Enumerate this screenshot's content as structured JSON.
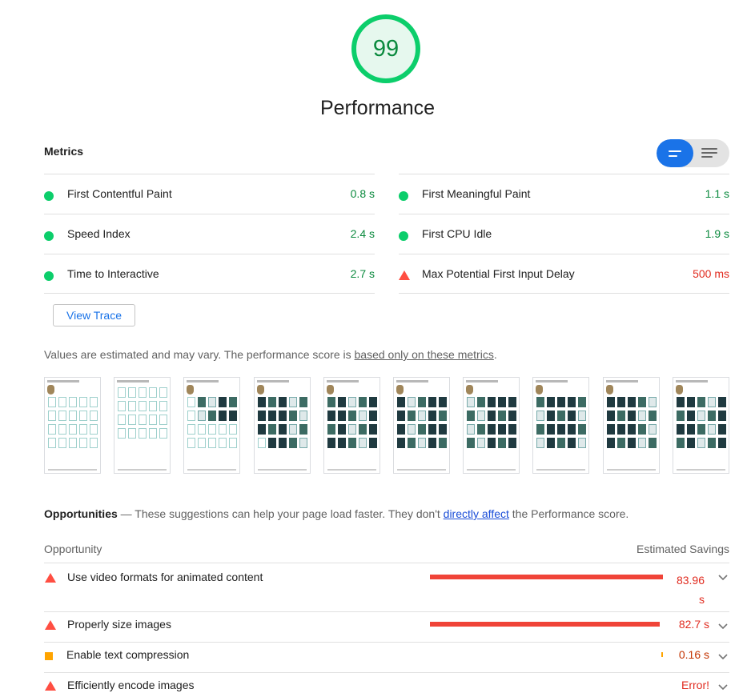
{
  "gauge": {
    "score": "99",
    "title": "Performance",
    "color": "#0cce6b"
  },
  "metrics": {
    "title": "Metrics",
    "toggle": {
      "selected": "summary-view",
      "options": [
        "summary-icon",
        "list-icon"
      ],
      "accent": "#1a73e8"
    },
    "items": [
      {
        "label": "First Contentful Paint",
        "value": "0.8 s",
        "status": "pass"
      },
      {
        "label": "First Meaningful Paint",
        "value": "1.1 s",
        "status": "pass"
      },
      {
        "label": "Speed Index",
        "value": "2.4 s",
        "status": "pass"
      },
      {
        "label": "First CPU Idle",
        "value": "1.9 s",
        "status": "pass"
      },
      {
        "label": "Time to Interactive",
        "value": "2.7 s",
        "status": "pass"
      },
      {
        "label": "Max Potential First Input Delay",
        "value": "500 ms",
        "status": "fail"
      }
    ],
    "view_trace_label": "View Trace",
    "note_prefix": "Values are estimated and may vary. The performance score is ",
    "note_link": "based only on these metrics",
    "note_suffix": "."
  },
  "filmstrip": {
    "frame_count": 10,
    "frame_states": [
      "empty",
      "empty",
      "partial",
      "loaded",
      "loaded",
      "loaded",
      "loaded",
      "loaded",
      "loaded",
      "loaded"
    ]
  },
  "opportunities": {
    "title": "Opportunities",
    "desc_prefix": " — These suggestions can help your page load faster. They don't ",
    "desc_link": "directly affect",
    "desc_suffix": " the Performance score.",
    "col_opportunity": "Opportunity",
    "col_savings": "Estimated Savings",
    "items": [
      {
        "label": "Use video formats for animated content",
        "savings": "83.96 s",
        "severity": "fail",
        "bar_fraction": 1.0
      },
      {
        "label": "Properly size images",
        "savings": "82.7 s",
        "severity": "fail",
        "bar_fraction": 0.985
      },
      {
        "label": "Enable text compression",
        "savings": "0.16 s",
        "severity": "average",
        "bar_fraction": 0.002
      },
      {
        "label": "Efficiently encode images",
        "savings": "Error!",
        "severity": "fail",
        "bar_fraction": 0
      }
    ]
  },
  "colors": {
    "pass": "#0cce6b",
    "fail": "#ff4e42",
    "average": "#ffa400",
    "link": "#1a73e8"
  }
}
